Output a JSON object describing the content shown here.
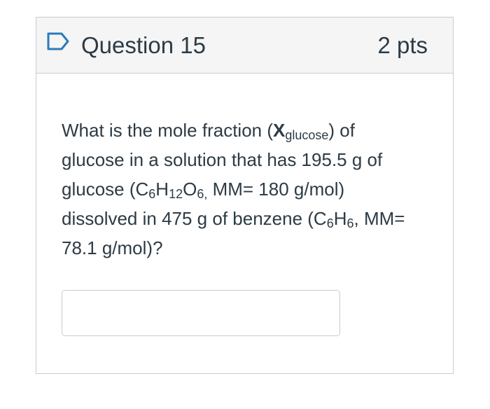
{
  "question": {
    "title": "Question 15",
    "points": "2 pts",
    "flag_icon": "bookmark-flag-icon",
    "text": {
      "part1": "What is the mole fraction (",
      "x_symbol": "X",
      "x_sub": "glucose",
      "part2": ") of glucose in a solution that has 195.5 g of glucose (C",
      "sub_c": "6",
      "h_text": "H",
      "sub_h": "12",
      "o_text": "O",
      "sub_o": "6,",
      "part3": " MM= 180 g/mol) dissolved in 475 g of benzene (C",
      "sub_c2": "6",
      "h2_text": "H",
      "sub_h2": "6",
      "part4": ", MM= 78.1 g/mol)?"
    }
  },
  "answer": {
    "value": "",
    "placeholder": ""
  },
  "colors": {
    "text": "#2d3b45",
    "border": "#c7cdd1",
    "header_bg": "#f5f5f5",
    "flag_stroke": "#2b7abc"
  }
}
